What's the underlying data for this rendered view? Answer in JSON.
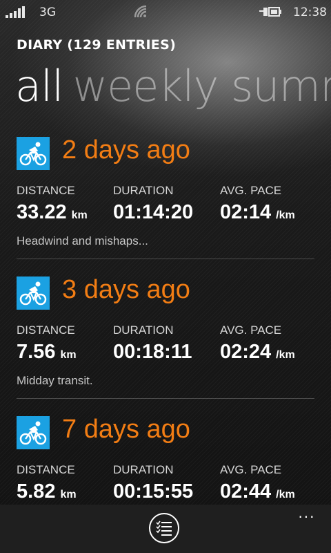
{
  "status": {
    "network": "3G",
    "time": "12:38"
  },
  "header": {
    "diary_title": "DIARY (129 ENTRIES)"
  },
  "pivot": {
    "active": "all",
    "inactive": "weekly summ"
  },
  "labels": {
    "distance": "DISTANCE",
    "duration": "DURATION",
    "pace": "AVG. PACE"
  },
  "entries": [
    {
      "when": "2 days ago",
      "distance": "33.22",
      "distance_unit": "km",
      "duration": "01:14:20",
      "pace": "02:14",
      "pace_unit": "/km",
      "note": "Headwind and mishaps..."
    },
    {
      "when": "3 days ago",
      "distance": "7.56",
      "distance_unit": "km",
      "duration": "00:18:11",
      "pace": "02:24",
      "pace_unit": "/km",
      "note": "Midday transit."
    },
    {
      "when": "7 days ago",
      "distance": "5.82",
      "distance_unit": "km",
      "duration": "00:15:55",
      "pace": "02:44",
      "pace_unit": "/km",
      "note": ""
    }
  ],
  "appbar": {
    "more": "..."
  },
  "icons": {
    "activity": "cycling-icon",
    "appbar": "checklist-icon"
  },
  "colors": {
    "accent_orange": "#f27d14",
    "tile_blue": "#1ba1e2"
  }
}
